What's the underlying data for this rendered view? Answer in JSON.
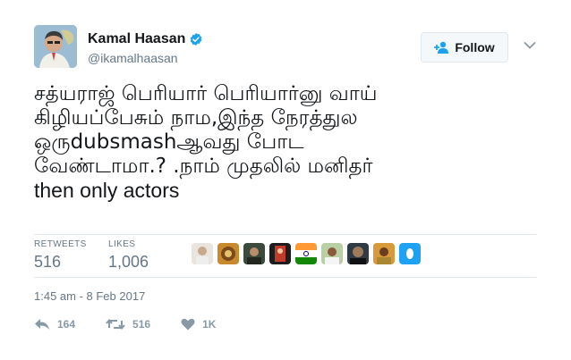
{
  "user": {
    "display_name": "Kamal Haasan",
    "handle": "@ikamalhaasan",
    "verified": true,
    "verified_color": "#1da1f2"
  },
  "follow_button": {
    "label": "Follow",
    "icon": "add-user-icon"
  },
  "tweet": {
    "lines": [
      "சத்யராஜ் பெரியார் பெரியார்னு வாய்",
      "கிழியப்பேசும் நாம,இந்த நேரத்துல",
      "ஒருdubsmashஆவது போட",
      "வேண்டாமா.? .நாம் முதலில் மனிதர்",
      "then only actors"
    ]
  },
  "stats": {
    "retweets_label": "RETWEETS",
    "retweets_value": "516",
    "likes_label": "LIKES",
    "likes_value": "1,006"
  },
  "likers": {
    "count_shown": 9
  },
  "timestamp": "1:45 am - 8 Feb 2017",
  "actions": {
    "reply_count": "164",
    "retweet_count": "516",
    "like_count": "1K"
  },
  "colors": {
    "text": "#14171a",
    "muted": "#657786",
    "action": "#8899a6",
    "border": "#e1e8ed"
  }
}
